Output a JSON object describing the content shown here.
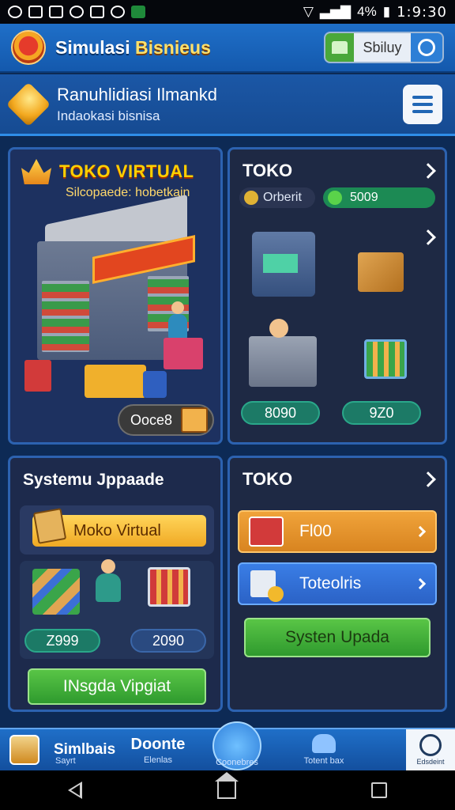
{
  "status_bar": {
    "battery": "4%",
    "time": "1:9:30"
  },
  "header": {
    "title_part1": "Simulasi",
    "title_part2": "Bisnieus",
    "pill_text": "Sbiluy"
  },
  "subheader": {
    "title": "Ranuhlidiasi Ilmankd",
    "subtitle": "Indaokasi bisnisa"
  },
  "panel_store": {
    "title": "TOKO VIRTUAL",
    "subtitle": "Silcopaede: hobetkain",
    "price": "Ooce8"
  },
  "panel_shop": {
    "title": "TOKO",
    "tag_left": "Orberit",
    "tag_right": "5009",
    "value_left": "8090",
    "value_right": "9Z0"
  },
  "panel_upgrade": {
    "title": "Systemu Jppaade",
    "yellow_label": "Moko Virtual",
    "value_left": "Z999",
    "value_right": "2090",
    "button_label": "INsgda Vipgiat"
  },
  "panel_toko": {
    "title": "TOKO",
    "orange_label": "Fl00",
    "blue_label": "Toteolris",
    "button_label": "Systen Upada"
  },
  "bottom_nav": {
    "item1_title": "Simlbais",
    "item1_sub": "Sayrt",
    "item2_title": "Doonte",
    "item2_sub": "Elenlas",
    "item3_sub": "Coonebres",
    "item4_sub": "Totent bax",
    "item5_sub": "Edsdeint"
  },
  "colors": {
    "header_blue": "#1f6fc8",
    "accent_yellow": "#ffd000",
    "green_button": "#2f9a2e",
    "orange_button": "#d88420",
    "blue_button": "#2b62c6"
  }
}
